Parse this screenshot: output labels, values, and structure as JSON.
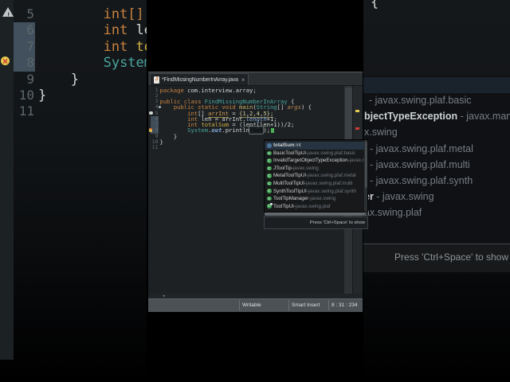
{
  "colors": {
    "keyword": "#c7823f",
    "type_class": "#48a59d",
    "method": "#c9b25a",
    "param": "#bd8a55",
    "field": "#85abdb",
    "local_gold": "#d2b245",
    "occurrence": "#cf9a4e",
    "plain": "#d4d7d2",
    "class_icon_green": "#3a9a4e",
    "field_icon_blue": "#4a7296",
    "selection_bg": "#263340",
    "status_bar_bg": "#4b5155",
    "caret_green": "#4cb052",
    "error_red": "#cf3d33",
    "warning_yellow": "#e6c94f",
    "quickdiff": "#3f4c57"
  },
  "icons": {
    "tab_file_icon_letter": "J",
    "h_scroll_arrow": "◂"
  },
  "background": {
    "editor": {
      "line4_tail": "{",
      "lines": [
        {
          "n": 5,
          "num": "5",
          "indent": 8,
          "icon": "warning",
          "tokens": [
            {
              "t": "int[]",
              "c": "kw"
            }
          ]
        },
        {
          "n": 6,
          "num": "6",
          "indent": 8,
          "changed": true,
          "tokens": [
            {
              "t": "int ",
              "c": "kw"
            },
            {
              "t": "le",
              "c": "plain"
            }
          ]
        },
        {
          "n": 7,
          "num": "7",
          "indent": 8,
          "changed": true,
          "tokens": [
            {
              "t": "int ",
              "c": "kw"
            },
            {
              "t": "to",
              "c": "gold"
            }
          ]
        },
        {
          "n": 8,
          "num": "8",
          "indent": 8,
          "changed": true,
          "icon": "error",
          "tokens": [
            {
              "t": "System",
              "c": "teal"
            }
          ]
        },
        {
          "n": 9,
          "num": "9",
          "indent": 4,
          "tokens": [
            {
              "t": "}",
              "c": "plain"
            }
          ]
        },
        {
          "n": 10,
          "num": "10",
          "indent": 0,
          "tokens": [
            {
              "t": "}",
              "c": "plain"
            }
          ]
        },
        {
          "n": 11,
          "num": "11",
          "indent": 0,
          "tokens": []
        }
      ]
    },
    "popup": {
      "rows": [
        {
          "name": "",
          "detail": "- javax.swing.plaf.basic",
          "x": 7
        },
        {
          "name": "bjectTypeException",
          "detail": " - javax.mana",
          "x": 1
        },
        {
          "name": "",
          "detail": "x.swing",
          "x": 1
        },
        {
          "name": "l",
          "detail": " - javax.swing.plaf.metal",
          "x": 1
        },
        {
          "name": "i",
          "detail": " - javax.swing.plaf.multi",
          "x": 1
        },
        {
          "name": "l",
          "detail": " - javax.swing.plaf.synth",
          "x": 1
        },
        {
          "name": "er",
          "detail": " - javax.swing",
          "x": 1
        },
        {
          "name": "",
          "detail": "ax.swing.plaf",
          "x": 1
        }
      ],
      "hint": "Press 'Ctrl+Space' to show"
    }
  },
  "pip": {
    "tab": {
      "title": "*FindMissingNumberInArray.java",
      "close": "×"
    },
    "code": {
      "lines": [
        {
          "n": 1,
          "num": "1",
          "indent": 0,
          "tokens": [
            {
              "t": "package ",
              "c": "kw"
            },
            {
              "t": "com.interview.array;",
              "c": "plain"
            }
          ]
        },
        {
          "n": 2,
          "num": "2",
          "indent": 0,
          "tokens": []
        },
        {
          "n": 3,
          "num": "3",
          "indent": 0,
          "tokens": [
            {
              "t": "public class ",
              "c": "kw"
            },
            {
              "t": "FindMissingNumberInArray",
              "c": "cls"
            },
            {
              "t": " {",
              "c": "plain"
            }
          ]
        },
        {
          "n": 4,
          "num": "4",
          "indent": 4,
          "marker": true,
          "tokens": [
            {
              "t": "public static void ",
              "c": "kw"
            },
            {
              "t": "main",
              "c": "meth"
            },
            {
              "t": "(",
              "c": "plain"
            },
            {
              "t": "String",
              "c": "cls"
            },
            {
              "t": "[] ",
              "c": "plain"
            },
            {
              "t": "args",
              "c": "param"
            },
            {
              "t": ") {",
              "c": "plain"
            }
          ]
        },
        {
          "n": 5,
          "num": "5",
          "indent": 8,
          "icon": "warning",
          "tokens": [
            {
              "t": "int",
              "c": "kw"
            },
            {
              "t": "[] ",
              "c": "plain"
            },
            {
              "t": "arrInt",
              "c": "occ"
            },
            {
              "t": " = ",
              "c": "plain"
            },
            {
              "t": "{1,2,4,5};",
              "c": "init"
            }
          ]
        },
        {
          "n": 6,
          "num": "6",
          "indent": 8,
          "changed": true,
          "tokens": [
            {
              "t": "int ",
              "c": "kw"
            },
            {
              "t": "len",
              "c": "plain"
            },
            {
              "t": " = arrInt.",
              "c": "plain"
            },
            {
              "t": "length",
              "c": "field"
            },
            {
              "t": "+1;",
              "c": "plain"
            }
          ]
        },
        {
          "n": 7,
          "num": "7",
          "indent": 8,
          "changed": true,
          "tokens": [
            {
              "t": "int ",
              "c": "kw"
            },
            {
              "t": "totalSum",
              "c": "gold"
            },
            {
              "t": " = (len*(len+1))/2;",
              "c": "plain"
            }
          ]
        },
        {
          "n": 8,
          "num": "8",
          "indent": 8,
          "changed": true,
          "icon": "error",
          "caret": true,
          "tokens": [
            {
              "t": "System",
              "c": "teal"
            },
            {
              "t": ".",
              "c": "plain"
            },
            {
              "t": "out",
              "c": "fieldb"
            },
            {
              "t": ".",
              "c": "plain"
            },
            {
              "t": "println",
              "c": "plain"
            },
            {
              "t": "(tot",
              "c": "box"
            },
            {
              "t": ");",
              "c": "plain"
            }
          ]
        },
        {
          "n": 9,
          "num": "9",
          "indent": 4,
          "tokens": [
            {
              "t": "}",
              "c": "plain"
            }
          ]
        },
        {
          "n": 10,
          "num": "10",
          "indent": 0,
          "tokens": [
            {
              "t": "}",
              "c": "plain"
            }
          ]
        },
        {
          "n": 11,
          "num": "11",
          "indent": 0,
          "tokens": []
        }
      ]
    },
    "popup": {
      "items": [
        {
          "kind": "field",
          "name": "totalSum",
          "sep": " : ",
          "detail": "int",
          "selected": true
        },
        {
          "kind": "class",
          "name": "BasicToolTipUI",
          "sep": " - ",
          "detail": "javax.swing.plaf.basic"
        },
        {
          "kind": "class",
          "name": "InvalidTargetObjectTypeException",
          "sep": " - ",
          "detail": "javax.mana"
        },
        {
          "kind": "class",
          "name": "JToolTip",
          "sep": " - ",
          "detail": "javax.swing"
        },
        {
          "kind": "class",
          "name": "MetalToolTipUI",
          "sep": " - ",
          "detail": "javax.swing.plaf.metal"
        },
        {
          "kind": "class",
          "name": "MultiToolTipUI",
          "sep": " - ",
          "detail": "javax.swing.plaf.multi"
        },
        {
          "kind": "class",
          "name": "SynthToolTipUI",
          "sep": " - ",
          "detail": "javax.swing.plaf.synth"
        },
        {
          "kind": "class",
          "name": "ToolTipManager",
          "sep": " - ",
          "detail": "javax.swing"
        },
        {
          "kind": "class-a",
          "name": "ToolTipUI",
          "sep": " - ",
          "detail": "javax.swing.plaf"
        }
      ],
      "hint": "Press 'Ctrl+Space' to show"
    },
    "status": {
      "items": [
        "Writable",
        "Smart Insert",
        "8 : 31 : 234"
      ]
    }
  }
}
